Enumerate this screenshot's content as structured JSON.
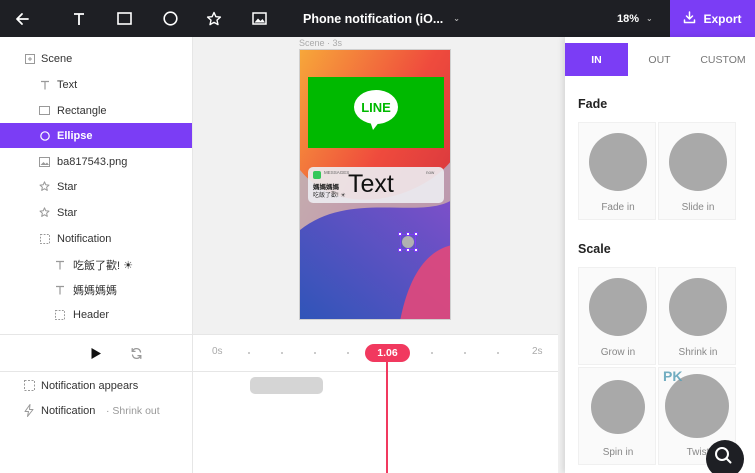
{
  "toolbar": {
    "back_icon": "arrow-left-icon",
    "tools": [
      "text-tool-icon",
      "rectangle-tool-icon",
      "ellipse-tool-icon",
      "star-tool-icon",
      "image-tool-icon"
    ],
    "title": "Phone notification (iO...",
    "zoom": "18%",
    "export_label": "Export"
  },
  "layers": {
    "items": [
      {
        "label": "Scene",
        "icon": "scene-icon",
        "indent": 0,
        "selected": false
      },
      {
        "label": "Text",
        "icon": "text-icon",
        "indent": 1,
        "selected": false
      },
      {
        "label": "Rectangle",
        "icon": "rectangle-icon",
        "indent": 1,
        "selected": false
      },
      {
        "label": "Ellipse",
        "icon": "ellipse-icon",
        "indent": 1,
        "selected": true
      },
      {
        "label": "ba817543.png",
        "icon": "image-icon",
        "indent": 1,
        "selected": false
      },
      {
        "label": "Star",
        "icon": "star-icon",
        "indent": 1,
        "selected": false
      },
      {
        "label": "Star",
        "icon": "star-icon",
        "indent": 1,
        "selected": false
      },
      {
        "label": "Notification",
        "icon": "group-icon",
        "indent": 1,
        "selected": false
      },
      {
        "label": "吃飯了歡! ☀",
        "icon": "text-icon",
        "indent": 2,
        "selected": false
      },
      {
        "label": "媽媽媽媽",
        "icon": "text-icon",
        "indent": 2,
        "selected": false
      },
      {
        "label": "Header",
        "icon": "group-icon",
        "indent": 2,
        "selected": false
      }
    ]
  },
  "canvas": {
    "scene_label": "Scene · 3s",
    "line_logo_text": "LINE",
    "notif_app": "MESSAGES",
    "notif_time": "now",
    "notif_title": "媽媽媽媽",
    "notif_body": "吃飯了歡! ☀",
    "overlay_text": "Text"
  },
  "timeline": {
    "start_label": "0s",
    "end_label": "2s",
    "playhead": "1.06",
    "tracks": [
      {
        "label": "Notification appears",
        "sub": "",
        "icon": "group-icon"
      },
      {
        "label": "Notification",
        "sub": "· Shrink out",
        "icon": "bolt-icon"
      }
    ]
  },
  "animations": {
    "tabs": [
      "IN",
      "OUT",
      "CUSTOM"
    ],
    "active_tab": "IN",
    "sections": [
      {
        "title": "Fade",
        "items": [
          "Fade in",
          "Slide in"
        ]
      },
      {
        "title": "Scale",
        "items": [
          "Grow in",
          "Shrink in",
          "Spin in",
          "Twist"
        ]
      }
    ]
  },
  "watermark": "PK",
  "colors": {
    "accent": "#7b3df5",
    "playhead": "#f1395f",
    "topbar": "#1e1f24",
    "line_green": "#00b900"
  }
}
